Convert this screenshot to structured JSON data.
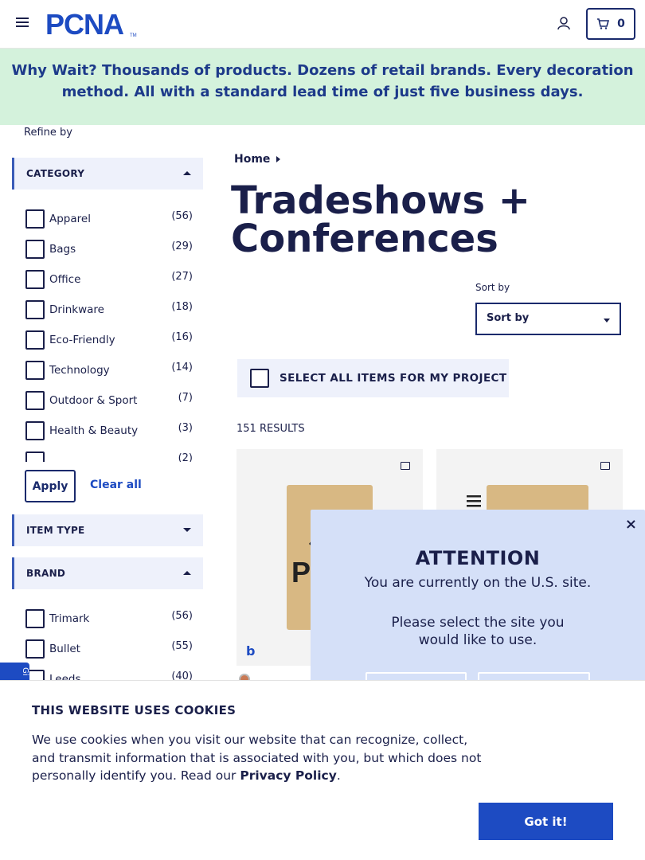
{
  "header": {
    "logo_text": "PCNA",
    "cart_count": "0"
  },
  "banner": {
    "lead": "Why Wait?",
    "text": " Thousands of products. Dozens of retail brands. Every decoration method. All with a standard lead time of just five business days."
  },
  "sidebar": {
    "refine_label": "Refine by",
    "category": {
      "heading": "CATEGORY",
      "expanded": true,
      "items": [
        {
          "label": "Apparel",
          "count": "(56)"
        },
        {
          "label": "Bags",
          "count": "(29)"
        },
        {
          "label": "Office",
          "count": "(27)"
        },
        {
          "label": "Drinkware",
          "count": "(18)"
        },
        {
          "label": "Eco-Friendly",
          "count": "(16)"
        },
        {
          "label": "Technology",
          "count": "(14)"
        },
        {
          "label": "Outdoor & Sport",
          "count": "(7)"
        },
        {
          "label": "Health & Beauty",
          "count": "(3)"
        },
        {
          "label": "",
          "count": "(2)"
        }
      ]
    },
    "apply_label": "Apply",
    "clear_label": "Clear all",
    "item_type": {
      "heading": "ITEM TYPE",
      "expanded": false
    },
    "brand": {
      "heading": "BRAND",
      "expanded": true,
      "items": [
        {
          "label": "Trimark",
          "count": "(56)"
        },
        {
          "label": "Bullet",
          "count": "(55)"
        },
        {
          "label": "Leeds",
          "count": "(40)"
        }
      ]
    },
    "gift_tab_label": "Gi"
  },
  "main": {
    "breadcrumb": "Home",
    "title": "Tradeshows + Conferences",
    "sort_label": "Sort by",
    "sort_value": "Sort by",
    "select_all_label": "SELECT ALL ITEMS FOR MY PROJECT",
    "results": "151 RESULTS",
    "cards": [
      {
        "name": "notebook-card-1",
        "badge": "b",
        "color": "#d8b883"
      },
      {
        "name": "notebook-card-2",
        "badge": "",
        "color": "#d8b883"
      }
    ]
  },
  "modal": {
    "close": "×",
    "title": "ATTENTION",
    "line1": "You are currently on the U.S. site.",
    "line2": "Please select the site you would like to use."
  },
  "cookie": {
    "title": "THIS WEBSITE USES COOKIES",
    "text": "We use cookies when you visit our website that can recognize, collect, and transmit information that is associated with you, but which does not personally identify you. Read our ",
    "link": "Privacy Policy",
    "tail": ".",
    "button": "Got it!"
  },
  "colors": {
    "brand_blue": "#1d4bc2",
    "navy": "#1a1f4a",
    "banner_bg": "#d4f2dc",
    "modal_bg": "#d5e0f8"
  }
}
